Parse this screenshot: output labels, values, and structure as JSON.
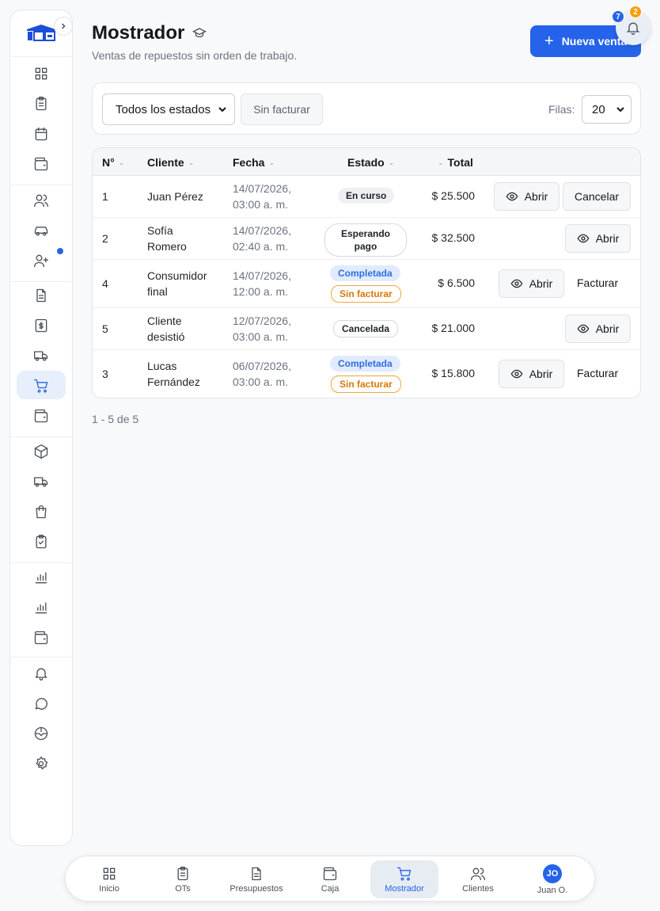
{
  "header": {
    "title": "Mostrador",
    "subtitle": "Ventas de repuestos sin orden de trabajo.",
    "new_button_label": "Nueva venta",
    "notifications_blue_count": "7",
    "notifications_orange_count": "2"
  },
  "filters": {
    "status_value": "Todos los estados",
    "unbilled_label": "Sin facturar",
    "rows_label": "Filas:",
    "rows_value": "20"
  },
  "table": {
    "columns": [
      "N°",
      "Cliente",
      "Fecha",
      "Estado",
      "Total"
    ],
    "rows": [
      {
        "num": "1",
        "client": "Juan Pérez",
        "date_l1": "14/07/2026,",
        "date_l2": "03:00 a. m.",
        "status": "En curso",
        "total": "$ 25.500",
        "open": "Abrir",
        "action": "Cancelar"
      },
      {
        "num": "2",
        "client_l1": "Sofía",
        "client_l2": "Romero",
        "date_l1": "14/07/2026,",
        "date_l2": "02:40 a. m.",
        "status_l1": "Esperando",
        "status_l2": "pago",
        "total": "$ 32.500",
        "open": "Abrir"
      },
      {
        "num": "4",
        "client_l1": "Consumidor",
        "client_l2": "final",
        "date_l1": "14/07/2026,",
        "date_l2": "12:00 a. m.",
        "status": "Completada",
        "status2": "Sin facturar",
        "total": "$ 6.500",
        "open": "Abrir",
        "action": "Facturar"
      },
      {
        "num": "5",
        "client_l1": "Cliente",
        "client_l2": "desistió",
        "date_l1": "12/07/2026,",
        "date_l2": "03:00 a. m.",
        "status": "Cancelada",
        "total": "$ 21.000",
        "open": "Abrir"
      },
      {
        "num": "3",
        "client_l1": "Lucas",
        "client_l2": "Fernández",
        "date_l1": "06/07/2026,",
        "date_l2": "03:00 a. m.",
        "status": "Completada",
        "status2": "Sin facturar",
        "total": "$ 15.800",
        "open": "Abrir",
        "action": "Facturar"
      }
    ]
  },
  "pagination": "1 - 5 de 5",
  "bottom_nav": {
    "items": [
      "Inicio",
      "OTs",
      "Presupuestos",
      "Caja",
      "Mostrador",
      "Clientes",
      "Juan O."
    ],
    "avatar_initials": "JO"
  },
  "colors": {
    "accent": "#2563eb",
    "warning": "#f59e0b"
  }
}
